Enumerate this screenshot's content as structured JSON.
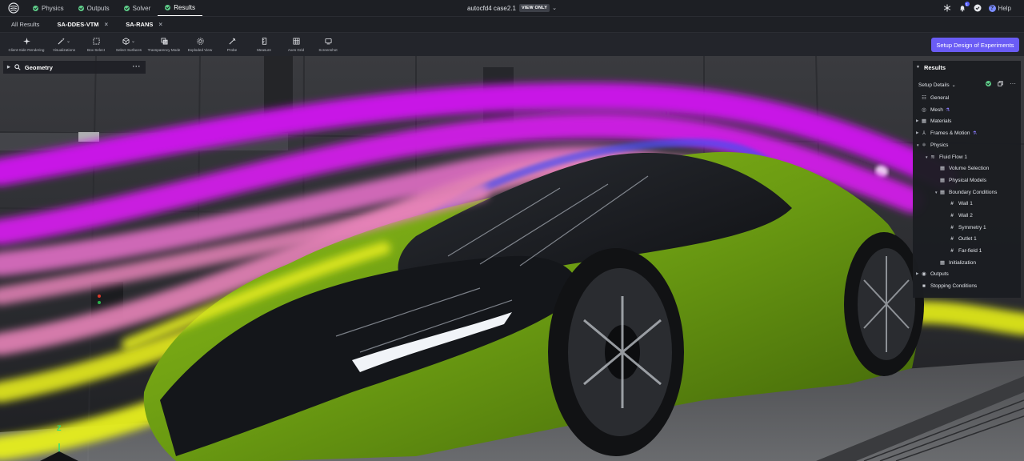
{
  "top_nav": {
    "tabs": [
      {
        "label": "Physics",
        "status": "complete"
      },
      {
        "label": "Outputs",
        "status": "complete"
      },
      {
        "label": "Solver",
        "status": "complete"
      },
      {
        "label": "Results",
        "status": "complete",
        "active": true
      }
    ],
    "project_name": "autocfd4 case2.1",
    "view_mode_badge": "VIEW ONLY",
    "notification_count": "1",
    "help_label": "Help"
  },
  "result_tabs": [
    {
      "label": "All Results",
      "closable": false
    },
    {
      "label": "SA-DDES-VTM",
      "closable": true,
      "bold": true
    },
    {
      "label": "SA-RANS",
      "closable": true,
      "bold": true
    }
  ],
  "toolbar": {
    "tools": [
      {
        "label": "Client-Side Rendering",
        "icon": "sparkle-icon"
      },
      {
        "label": "Visualizations",
        "icon": "wand-icon"
      },
      {
        "label": "Box Select",
        "icon": "box-select-icon"
      },
      {
        "label": "Select Surfaces",
        "icon": "cube-icon"
      },
      {
        "label": "Transparency Mode",
        "icon": "layers-icon"
      },
      {
        "label": "Exploded View",
        "icon": "explode-icon"
      },
      {
        "label": "Probe",
        "icon": "probe-icon"
      },
      {
        "label": "Measure",
        "icon": "ruler-icon"
      },
      {
        "label": "Axes Grid",
        "icon": "grid-icon"
      },
      {
        "label": "Screenshot",
        "icon": "screenshot-icon"
      }
    ],
    "setup_doe_label": "Setup Design of Experiments"
  },
  "geometry_panel": {
    "title": "Geometry"
  },
  "results_panel": {
    "title": "Results",
    "setup_details_label": "Setup Details",
    "tree": [
      {
        "label": "General",
        "icon": "sliders-icon"
      },
      {
        "label": "Mesh",
        "icon": "mesh-icon",
        "flask": true
      },
      {
        "label": "Materials",
        "icon": "materials-icon",
        "expandable": true
      },
      {
        "label": "Frames & Motion",
        "icon": "frames-icon",
        "expandable": true,
        "flask": true
      },
      {
        "label": "Physics",
        "icon": "physics-icon",
        "expanded": true
      },
      {
        "label": "Fluid Flow 1",
        "icon": "flow-icon",
        "expanded": true
      },
      {
        "label": "Volume Selection",
        "icon": "volume-icon"
      },
      {
        "label": "Physical Models",
        "icon": "models-icon"
      },
      {
        "label": "Boundary Conditions",
        "icon": "boundary-icon",
        "expanded": true
      },
      {
        "label": "Wall 1",
        "icon": "hash-icon"
      },
      {
        "label": "Wall 2",
        "icon": "hash-icon"
      },
      {
        "label": "Symmetry 1",
        "icon": "hash-icon"
      },
      {
        "label": "Outlet 1",
        "icon": "hash-icon"
      },
      {
        "label": "Far-field 1",
        "icon": "hash-icon"
      },
      {
        "label": "Initialization",
        "icon": "init-icon"
      },
      {
        "label": "Outputs",
        "icon": "outputs-icon",
        "expandable": true
      },
      {
        "label": "Stopping Conditions",
        "icon": "stop-icon"
      }
    ]
  },
  "axis_label": "Z",
  "colors": {
    "accent": "#6a5cf5",
    "success": "#5fcf8a",
    "streamline_magenta": "#d21ee8",
    "streamline_pink": "#e46fbd",
    "streamline_yellow": "#e7ef1a",
    "car_green": "#6a9a12"
  }
}
